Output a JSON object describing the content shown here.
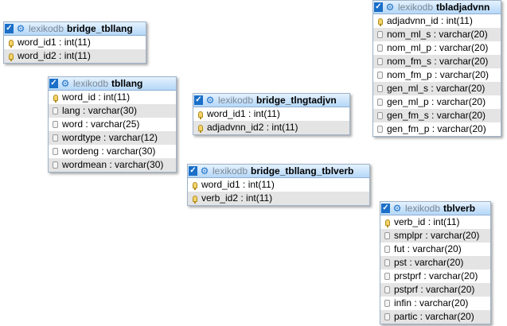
{
  "tables": {
    "bridge_tbllang": {
      "db": "lexikodb",
      "name": "bridge_tbllang",
      "columns": [
        {
          "text": "word_id1 : int(11)",
          "key": true
        },
        {
          "text": "word_id2 : int(11)",
          "key": true
        }
      ]
    },
    "tbllang": {
      "db": "lexikodb",
      "name": "tbllang",
      "columns": [
        {
          "text": "word_id : int(11)",
          "key": true
        },
        {
          "text": "lang : varchar(30)",
          "key": false
        },
        {
          "text": "word : varchar(25)",
          "key": false
        },
        {
          "text": "wordtype : varchar(12)",
          "key": false
        },
        {
          "text": "wordeng : varchar(30)",
          "key": false
        },
        {
          "text": "wordmean : varchar(30)",
          "key": false
        }
      ]
    },
    "bridge_tlngtadjvn": {
      "db": "lexikodb",
      "name": "bridge_tlngtadjvn",
      "columns": [
        {
          "text": "word_id1 : int(11)",
          "key": true
        },
        {
          "text": "adjadvnn_id2 : int(11)",
          "key": true
        }
      ]
    },
    "bridge_tbllang_tblverb": {
      "db": "lexikodb",
      "name": "bridge_tbllang_tblverb",
      "columns": [
        {
          "text": "word_id1 : int(11)",
          "key": true
        },
        {
          "text": "verb_id2 : int(11)",
          "key": true
        }
      ]
    },
    "tbladjadvnn": {
      "db": "lexikodb",
      "name": "tbladjadvnn",
      "columns": [
        {
          "text": "adjadvnn_id : int(11)",
          "key": true
        },
        {
          "text": "nom_ml_s : varchar(20)",
          "key": false
        },
        {
          "text": "nom_ml_p : varchar(20)",
          "key": false
        },
        {
          "text": "nom_fm_s : varchar(20)",
          "key": false
        },
        {
          "text": "nom_fm_p : varchar(20)",
          "key": false
        },
        {
          "text": "gen_ml_s : varchar(20)",
          "key": false
        },
        {
          "text": "gen_ml_p : varchar(20)",
          "key": false
        },
        {
          "text": "gen_fm_s : varchar(20)",
          "key": false
        },
        {
          "text": "gen_fm_p : varchar(20)",
          "key": false
        }
      ]
    },
    "tblverb": {
      "db": "lexikodb",
      "name": "tblverb",
      "columns": [
        {
          "text": "verb_id : int(11)",
          "key": true
        },
        {
          "text": "smplpr : varchar(20)",
          "key": false
        },
        {
          "text": "fut : varchar(20)",
          "key": false
        },
        {
          "text": "pst : varchar(20)",
          "key": false
        },
        {
          "text": "prstprf : varchar(20)",
          "key": false
        },
        {
          "text": "pstprf : varchar(20)",
          "key": false
        },
        {
          "text": "infin : varchar(20)",
          "key": false
        },
        {
          "text": "partic : varchar(20)",
          "key": false
        }
      ]
    }
  }
}
